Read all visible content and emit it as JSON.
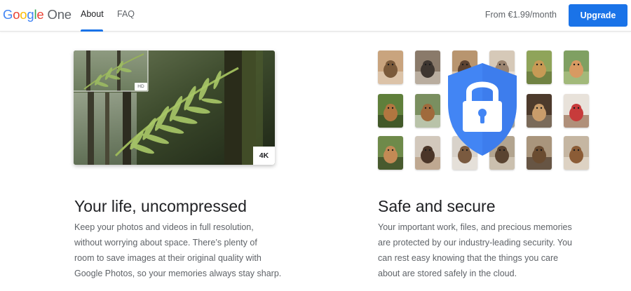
{
  "header": {
    "logo_word": "Google",
    "logo_product": "One",
    "nav": [
      {
        "label": "About",
        "active": true
      },
      {
        "label": "FAQ",
        "active": false
      }
    ],
    "price": "From €1.99/month",
    "upgrade_label": "Upgrade"
  },
  "colors": {
    "accent": "#1a73e8",
    "google_blue": "#4285F4",
    "google_red": "#EA4335",
    "google_yellow": "#FBBC05",
    "google_green": "#34A853"
  },
  "features": [
    {
      "image_badges": {
        "small": "HD",
        "large": "4K"
      },
      "title": "Your life, uncompressed",
      "body_lines": [
        "Keep your photos and videos in full resolution,",
        "without worrying about space. There’s plenty of",
        "room to save images at their original quality with",
        "Google Photos, so your memories always stay sharp."
      ]
    },
    {
      "icon": "shield-lock-icon",
      "title": "Safe and secure",
      "body_lines": [
        "Your important work, files, and precious memories",
        "are protected by our industry-leading security. You",
        "can rest easy knowing that the things you care",
        "about are stored safely in the cloud."
      ]
    }
  ]
}
